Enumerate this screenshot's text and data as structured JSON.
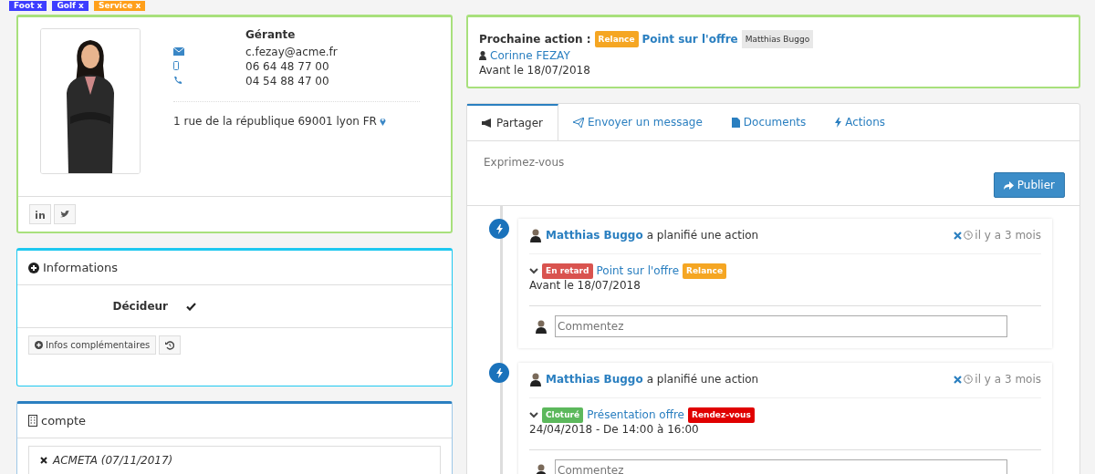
{
  "tags": [
    {
      "label": "Foot x",
      "color": "#3d3dff"
    },
    {
      "label": "Golf x",
      "color": "#3d3dff"
    },
    {
      "label": "Service x",
      "color": "#ff9f1a"
    }
  ],
  "contact": {
    "role": "Gérante",
    "email": "c.fezay@acme.fr",
    "mobile": "06 64 48 77 00",
    "phone": "04 54 88 47 00",
    "address": "1 rue de la république 69001 lyon FR"
  },
  "informations": {
    "title": "Informations",
    "fields": [
      {
        "label": "Décideur",
        "checked": true
      }
    ],
    "more_button": "Infos complémentaires"
  },
  "compte": {
    "title": "compte",
    "items": [
      "ACMETA (07/11/2017)"
    ]
  },
  "next_action": {
    "label": "Prochaine action :",
    "tag": {
      "label": "Relance",
      "color": "#f5a623"
    },
    "title": "Point sur l'offre",
    "owner": "Matthias Buggo",
    "contact": "Corinne FEZAY",
    "due": "Avant le 18/07/2018"
  },
  "tabs": [
    {
      "label": "Partager",
      "selected": true
    },
    {
      "label": "Envoyer un message",
      "selected": false
    },
    {
      "label": "Documents",
      "selected": false
    },
    {
      "label": "Actions",
      "selected": false
    }
  ],
  "post": {
    "placeholder": "Exprimez-vous",
    "button": "Publier"
  },
  "timeline": [
    {
      "author": "Matthias Buggo",
      "verb": "a planifié une action",
      "time": "il y a 3 mois",
      "status": {
        "label": "En retard",
        "color": "#d9534f"
      },
      "title": "Point sur l'offre",
      "type": {
        "label": "Relance",
        "color": "#f5a623"
      },
      "detail": "Avant le 18/07/2018",
      "comment_placeholder": "Commentez"
    },
    {
      "author": "Matthias Buggo",
      "verb": "a planifié une action",
      "time": "il y a 3 mois",
      "status": {
        "label": "Cloturé",
        "color": "#5cb85c"
      },
      "title": "Présentation offre",
      "type": {
        "label": "Rendez-vous",
        "color": "#e00000"
      },
      "detail": "24/04/2018 - De 14:00 à 16:00",
      "comment_placeholder": "Commentez"
    }
  ]
}
